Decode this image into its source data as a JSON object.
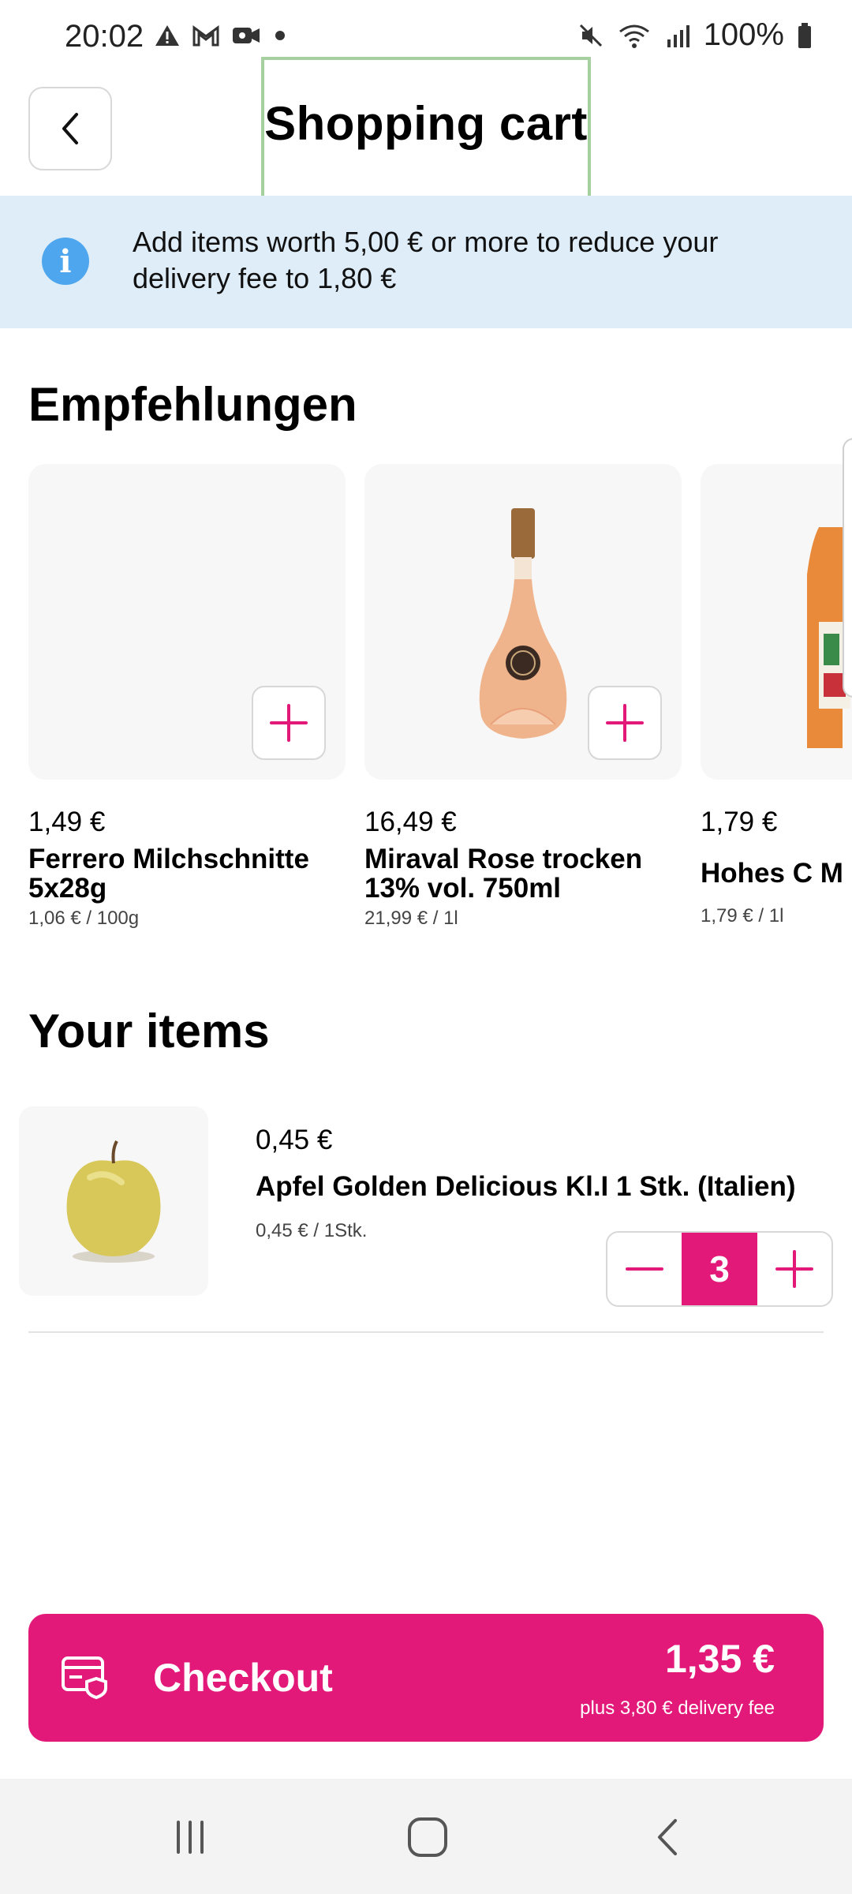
{
  "status_bar": {
    "time": "20:02",
    "battery": "100%",
    "icons": [
      "warning-icon",
      "gmail-icon",
      "video-icon",
      "dot-icon",
      "mute-icon",
      "wifi-icon",
      "signal-icon",
      "battery-icon"
    ]
  },
  "header": {
    "title": "Shopping cart",
    "back_icon": "chevron-left-icon"
  },
  "banner": {
    "icon": "info-icon",
    "icon_glyph": "i",
    "text": "Add items worth 5,00 € or more to reduce your delivery fee to 1,80 €"
  },
  "recommendations": {
    "title": "Empfehlungen",
    "items": [
      {
        "price": "1,49 €",
        "name": "Ferrero Milchschnitte 5x28g",
        "unit_price": "1,06 € / 100g"
      },
      {
        "price": "16,49 €",
        "name": "Miraval Rose trocken 13% vol. 750ml",
        "unit_price": "21,99 € / 1l"
      },
      {
        "price": "1,79 €",
        "name": "Hohes C M",
        "unit_price": "1,79 € / 1l"
      }
    ]
  },
  "your_items": {
    "title": "Your items",
    "items": [
      {
        "price": "0,45 €",
        "name": "Apfel Golden Delicious Kl.I 1 Stk. (Italien)",
        "unit_price": "0,45 € / 1Stk.",
        "quantity": "3"
      }
    ]
  },
  "checkout": {
    "label": "Checkout",
    "total": "1,35 €",
    "fee": "plus 3,80 € delivery fee"
  },
  "colors": {
    "accent": "#e3197a",
    "banner_bg": "#deedf8",
    "info_blue": "#4ea7ee"
  }
}
